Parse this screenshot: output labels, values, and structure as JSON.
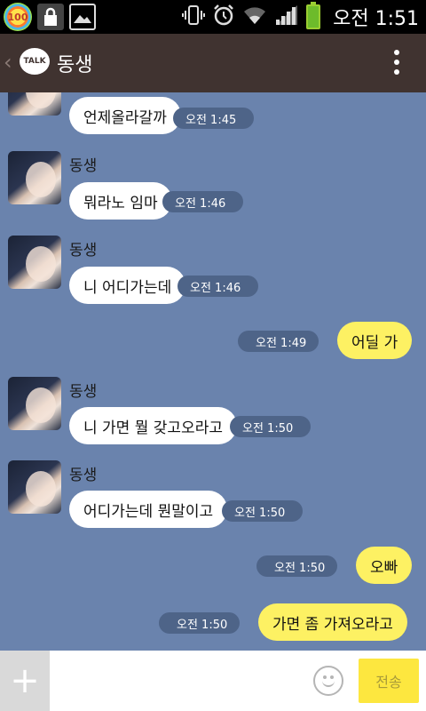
{
  "status_bar": {
    "badge": "100",
    "time": "오전 1:51"
  },
  "header": {
    "logo_text": "TALK",
    "title": "동생"
  },
  "messages": [
    {
      "dir": "in",
      "text": "언제올라갈까",
      "time": "오전 1:45"
    },
    {
      "dir": "in",
      "sender": "동생",
      "text": "뭐라노 임마",
      "time": "오전 1:46"
    },
    {
      "dir": "in",
      "sender": "동생",
      "text": "니 어디가는데",
      "time": "오전 1:46"
    },
    {
      "dir": "out",
      "text": "어딜 가",
      "time": "오전 1:49"
    },
    {
      "dir": "in",
      "sender": "동생",
      "text": "니 가면 뭘 갖고오라고",
      "time": "오전 1:50"
    },
    {
      "dir": "in",
      "sender": "동생",
      "text": "어디가는데 뭔말이고",
      "time": "오전 1:50"
    },
    {
      "dir": "out",
      "text": "오빠",
      "time": "오전 1:50"
    },
    {
      "dir": "out",
      "text": "가면 좀 가져오라고",
      "time": "오전 1:50"
    }
  ],
  "input_bar": {
    "plus_label": "+",
    "placeholder": "",
    "send_label": "전송"
  }
}
